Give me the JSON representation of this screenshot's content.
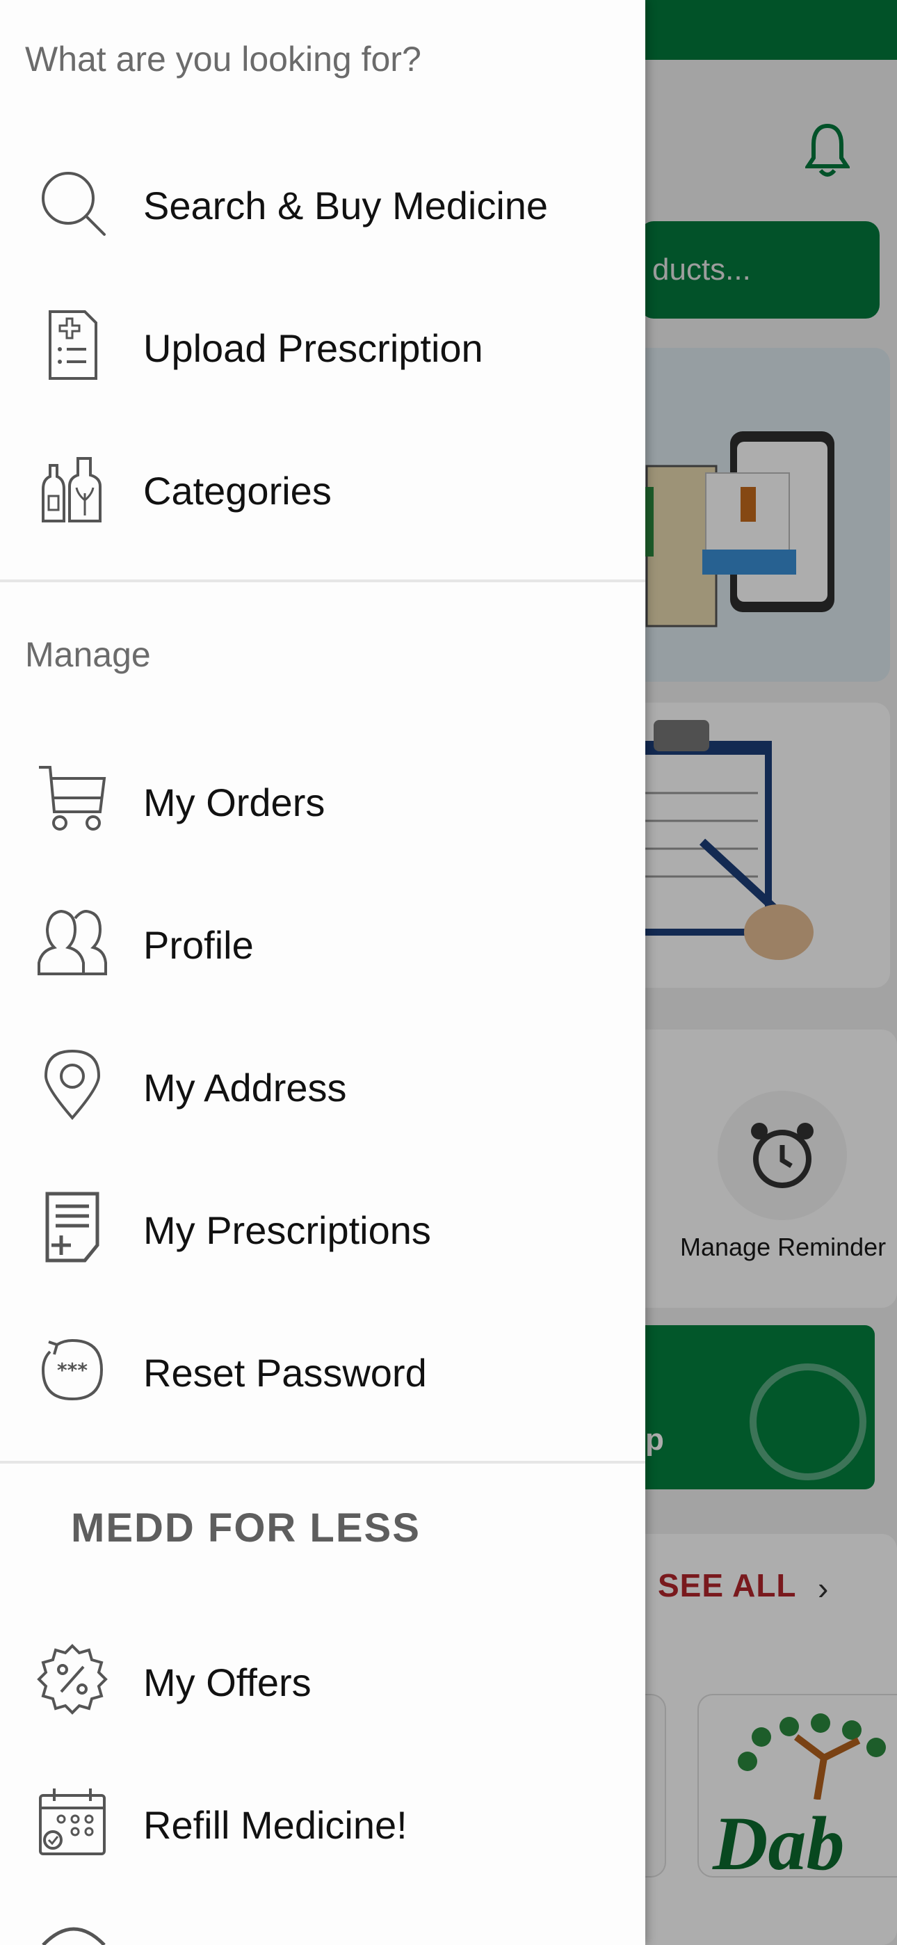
{
  "background": {
    "search_placeholder_partial": "ducts...",
    "reminder_label": "Manage Reminder",
    "whatsapp_partial": "p",
    "see_all_label": "SEE ALL",
    "see_all_chevron": "›",
    "brand_partial": "Dab",
    "colors": {
      "topbar": "#027a3c",
      "accent_green": "#037a3d",
      "see_all": "#b3262b"
    }
  },
  "drawer": {
    "section_looking_for": "What are you looking for?",
    "looking_for_items": [
      {
        "label": "Search & Buy Medicine",
        "icon": "search-icon"
      },
      {
        "label": "Upload Prescription",
        "icon": "prescription-upload-icon"
      },
      {
        "label": "Categories",
        "icon": "categories-bottles-icon"
      }
    ],
    "section_manage": "Manage",
    "manage_items": [
      {
        "label": "My Orders",
        "icon": "cart-icon"
      },
      {
        "label": "Profile",
        "icon": "profile-users-icon"
      },
      {
        "label": "My Address",
        "icon": "location-pin-icon"
      },
      {
        "label": "My Prescriptions",
        "icon": "prescription-doc-icon"
      },
      {
        "label": "Reset Password",
        "icon": "reset-password-icon"
      }
    ],
    "brand_heading": "MEDD FOR LESS",
    "brand_items": [
      {
        "label": "My Offers",
        "icon": "offer-badge-icon"
      },
      {
        "label": "Refill Medicine!",
        "icon": "calendar-refill-icon"
      }
    ]
  }
}
